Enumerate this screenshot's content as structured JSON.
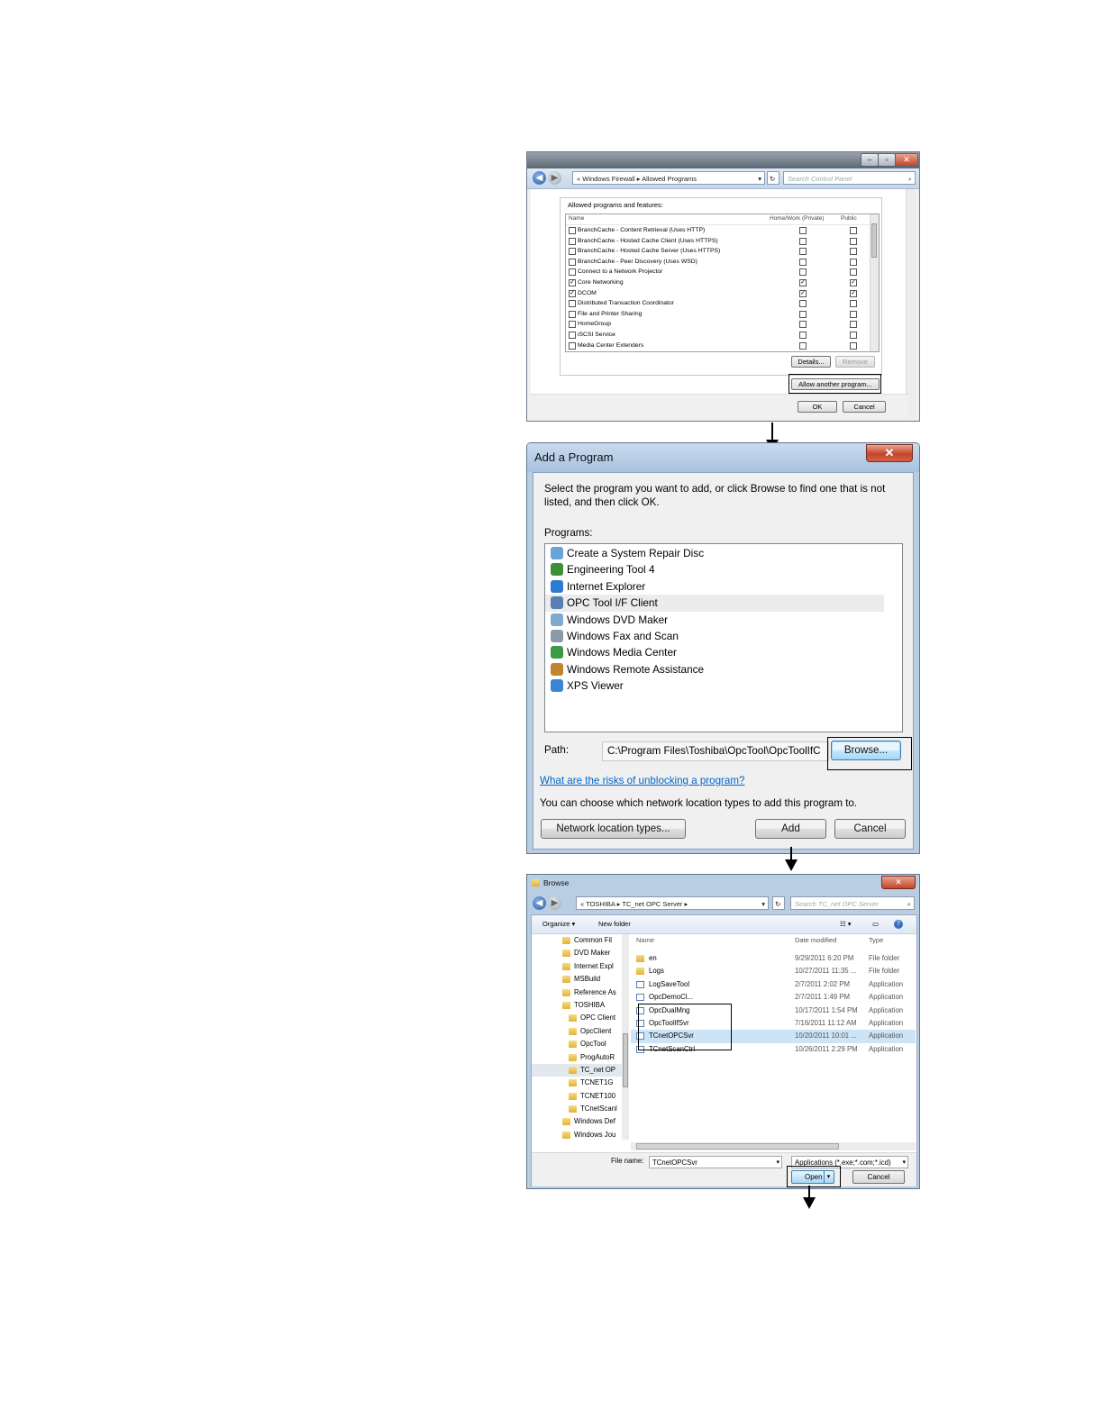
{
  "colors": {
    "link": "#0066cc",
    "selection": "#cde4f7",
    "close_red": "#c4452b"
  },
  "firewall": {
    "caption_buttons": [
      "–",
      "▫",
      "✕"
    ],
    "breadcrumb": {
      "prefix": "«",
      "items": [
        "Windows Firewall",
        "Allowed Programs"
      ],
      "separator": "▸"
    },
    "search_placeholder": "Search Control Panel",
    "group_title": "Allowed programs and features:",
    "columns": {
      "name": "Name",
      "home": "Home/Work (Private)",
      "public": "Public"
    },
    "rows": [
      {
        "name": "BranchCache - Content Retrieval (Uses HTTP)",
        "enabled": "",
        "home": "",
        "public": ""
      },
      {
        "name": "BranchCache - Hosted Cache Client (Uses HTTPS)",
        "enabled": "",
        "home": "",
        "public": ""
      },
      {
        "name": "BranchCache - Hosted Cache Server (Uses HTTPS)",
        "enabled": "",
        "home": "",
        "public": ""
      },
      {
        "name": "BranchCache - Peer Discovery (Uses WSD)",
        "enabled": "",
        "home": "",
        "public": ""
      },
      {
        "name": "Connect to a Network Projector",
        "enabled": "",
        "home": "",
        "public": ""
      },
      {
        "name": "Core Networking",
        "enabled": "✓",
        "home": "✓",
        "public": "✓"
      },
      {
        "name": "DCOM",
        "enabled": "✓",
        "home": "✓",
        "public": "✓"
      },
      {
        "name": "Distributed Transaction Coordinator",
        "enabled": "",
        "home": "",
        "public": ""
      },
      {
        "name": "File and Printer Sharing",
        "enabled": "",
        "home": "",
        "public": ""
      },
      {
        "name": "HomeGroup",
        "enabled": "",
        "home": "",
        "public": ""
      },
      {
        "name": "iSCSI Service",
        "enabled": "",
        "home": "",
        "public": ""
      },
      {
        "name": "Media Center Extenders",
        "enabled": "",
        "home": "",
        "public": ""
      }
    ],
    "details_label": "Details...",
    "remove_label": "Remove",
    "allow_another_label": "Allow another program...",
    "ok_label": "OK",
    "cancel_label": "Cancel"
  },
  "add_program": {
    "title": "Add a Program",
    "close_glyph": "✕",
    "intro": "Select the program you want to add, or click Browse to find one that is not listed, and then click OK.",
    "programs_label": "Programs:",
    "programs": [
      {
        "name": "Create a System Repair Disc",
        "icon_color": "#6aa3d8"
      },
      {
        "name": "Engineering Tool 4",
        "icon_color": "#3f8f3a"
      },
      {
        "name": "Internet Explorer",
        "icon_color": "#2e7cd1"
      },
      {
        "name": "OPC Tool I/F Client",
        "icon_color": "#5a7fb5"
      },
      {
        "name": "Windows DVD Maker",
        "icon_color": "#7fa9cf"
      },
      {
        "name": "Windows Fax and Scan",
        "icon_color": "#8c9aa8"
      },
      {
        "name": "Windows Media Center",
        "icon_color": "#3b9a45"
      },
      {
        "name": "Windows Remote Assistance",
        "icon_color": "#c0862f"
      },
      {
        "name": "XPS Viewer",
        "icon_color": "#3a86d4"
      }
    ],
    "selected_index": 3,
    "path_label": "Path:",
    "path_value": "C:\\Program Files\\Toshiba\\OpcTool\\OpcToolIfC",
    "browse_label": "Browse...",
    "link_text": "What are the risks of unblocking a program?",
    "network_note": "You can choose which network location types to add this program to.",
    "network_button": "Network location types...",
    "add_label": "Add",
    "cancel_label": "Cancel"
  },
  "browse": {
    "title": "Browse",
    "close_glyph": "✕",
    "breadcrumb": {
      "prefix": "«",
      "items": [
        "TOSHIBA",
        "TC_net OPC Server"
      ],
      "separator": "▸"
    },
    "search_placeholder": "Search TC_net OPC Server",
    "organize_label": "Organize ▾",
    "new_folder_label": "New folder",
    "tree": [
      {
        "name": "Common Fil",
        "indent": 0
      },
      {
        "name": "DVD Maker",
        "indent": 0
      },
      {
        "name": "Internet Expl",
        "indent": 0
      },
      {
        "name": "MSBuild",
        "indent": 0
      },
      {
        "name": "Reference As",
        "indent": 0
      },
      {
        "name": "TOSHIBA",
        "indent": 0
      },
      {
        "name": "OPC Client",
        "indent": 1
      },
      {
        "name": "OpcClient",
        "indent": 1
      },
      {
        "name": "OpcTool",
        "indent": 1
      },
      {
        "name": "ProgAutoR",
        "indent": 1
      },
      {
        "name": "TC_net OP",
        "indent": 1
      },
      {
        "name": "TCNET1G",
        "indent": 1
      },
      {
        "name": "TCNET100",
        "indent": 1
      },
      {
        "name": "TCnetScanl",
        "indent": 1
      },
      {
        "name": "Windows Def",
        "indent": 0
      },
      {
        "name": "Windows Jou",
        "indent": 0
      }
    ],
    "tree_selected_index": 10,
    "columns": {
      "name": "Name",
      "date": "Date modified",
      "type": "Type"
    },
    "files": [
      {
        "name": "en",
        "date": "9/29/2011 6:20 PM",
        "type": "File folder",
        "kind": "folder"
      },
      {
        "name": "Logs",
        "date": "10/27/2011 11:35 ...",
        "type": "File folder",
        "kind": "folder"
      },
      {
        "name": "LogSaveTool",
        "date": "2/7/2011 2:02 PM",
        "type": "Application",
        "kind": "app"
      },
      {
        "name": "OpcDemoCl...",
        "date": "2/7/2011 1:49 PM",
        "type": "Application",
        "kind": "app"
      },
      {
        "name": "OpcDualMng",
        "date": "10/17/2011 1:54 PM",
        "type": "Application",
        "kind": "app"
      },
      {
        "name": "OpcToolIfSvr",
        "date": "7/16/2011 11:12 AM",
        "type": "Application",
        "kind": "app"
      },
      {
        "name": "TCnetOPCSvr",
        "date": "10/20/2011 10:01 ...",
        "type": "Application",
        "kind": "app"
      },
      {
        "name": "TCnetScanCtrl",
        "date": "10/26/2011 2:29 PM",
        "type": "Application",
        "kind": "app"
      }
    ],
    "files_selected_index": 6,
    "file_name_label": "File name:",
    "file_name_value": "TCnetOPCSvr",
    "filter_value": "Applications (*.exe;*.com;*.icd)",
    "open_label": "Open",
    "cancel_label": "Cancel"
  }
}
